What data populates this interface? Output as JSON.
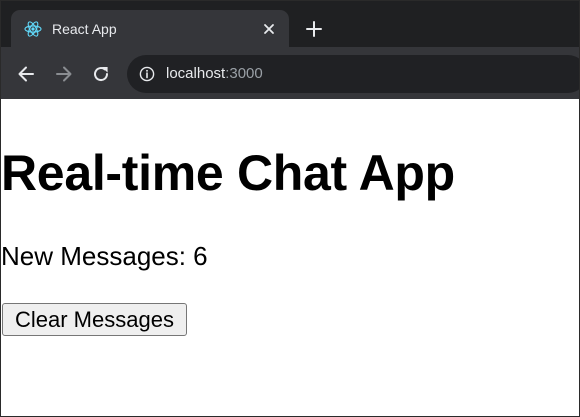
{
  "browser": {
    "tab": {
      "title": "React App",
      "favicon": "react-logo-icon"
    },
    "toolbar": {
      "back_icon": "arrow-left-icon",
      "forward_icon": "arrow-right-icon",
      "reload_icon": "reload-icon",
      "address": {
        "info_icon": "info-icon",
        "host": "localhost",
        "port": ":3000"
      }
    },
    "colors": {
      "tabstrip": "#1f2022",
      "active_tab": "#35363a",
      "omnibox": "#202124",
      "react_blue": "#61dafb"
    }
  },
  "page": {
    "title": "Real-time Chat App",
    "message_count_text": "New Messages: 6",
    "clear_button_label": "Clear Messages"
  }
}
